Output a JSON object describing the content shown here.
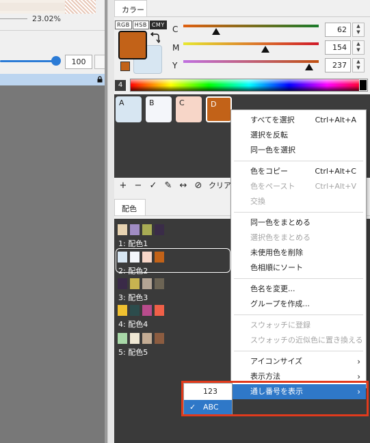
{
  "left_panel": {
    "percent": "23.02%",
    "opacity_value": "100"
  },
  "color_panel": {
    "tab_label": "カラー",
    "mode_tabs": [
      "RGB",
      "HSB",
      "CMY"
    ],
    "active_mode": "CMY",
    "main_color": "#c26218",
    "sub_color": "#d7e6f2",
    "channels": [
      {
        "label": "C",
        "value": "62",
        "start_color": "#e06010",
        "end_color": "#1a7a2a"
      },
      {
        "label": "M",
        "value": "154",
        "start_color": "#e8e830",
        "end_color": "#d01828"
      },
      {
        "label": "Y",
        "value": "237",
        "start_color": "#c070e0",
        "end_color": "#c05010"
      }
    ],
    "spectrum_number": "4"
  },
  "swatches": [
    {
      "label": "A",
      "color": "#d7e6f2"
    },
    {
      "label": "B",
      "color": "#f4f6fa"
    },
    {
      "label": "C",
      "color": "#f7d6c8"
    },
    {
      "label": "D",
      "color": "#c26218"
    }
  ],
  "swatch_toolbar": {
    "clear_label": "クリア"
  },
  "haishoku_panel": {
    "tab_label": "配色",
    "sets": [
      {
        "label": "1: 配色1",
        "colors": [
          "#e6d2b0",
          "#a08cc4",
          "#a8ac54",
          "#3a2c48"
        ]
      },
      {
        "label": "2: 配色2",
        "colors": [
          "#d7e6f2",
          "#f4f6fa",
          "#f7d6c8",
          "#c26218"
        ]
      },
      {
        "label": "3: 配色3",
        "colors": [
          "#3a2a48",
          "#c8b450",
          "#b4a494",
          "#6c6454"
        ]
      },
      {
        "label": "4: 配色4",
        "colors": [
          "#f0c030",
          "#2c4c4c",
          "#b84c8c",
          "#f06048"
        ]
      },
      {
        "label": "5: 配色5",
        "colors": [
          "#a8d8a8",
          "#f0e8d4",
          "#c4ac94",
          "#8c5c40"
        ]
      }
    ]
  },
  "context_menu": {
    "select_all": {
      "label": "すべてを選択",
      "shortcut": "Ctrl+Alt+A"
    },
    "invert_selection": {
      "label": "選択を反転"
    },
    "select_same": {
      "label": "同一色を選択"
    },
    "copy_color": {
      "label": "色をコピー",
      "shortcut": "Ctrl+Alt+C"
    },
    "paste_color": {
      "label": "色をペースト",
      "shortcut": "Ctrl+Alt+V"
    },
    "replace": {
      "label": "交換"
    },
    "merge_same": {
      "label": "同一色をまとめる"
    },
    "merge_selected": {
      "label": "選択色をまとめる"
    },
    "delete_unused": {
      "label": "未使用色を削除"
    },
    "sort_hue": {
      "label": "色相順にソート"
    },
    "rename_color": {
      "label": "色名を変更..."
    },
    "create_group": {
      "label": "グループを作成..."
    },
    "register_swatch": {
      "label": "スウォッチに登録"
    },
    "replace_nearest": {
      "label": "スウォッチの近似色に置き換える"
    },
    "icon_size": {
      "label": "アイコンサイズ"
    },
    "display_method": {
      "label": "表示方法"
    },
    "show_serial": {
      "label": "通し番号を表示"
    }
  },
  "submenu": {
    "option_123": "123",
    "option_abc": "ABC",
    "checkmark": "✓"
  }
}
